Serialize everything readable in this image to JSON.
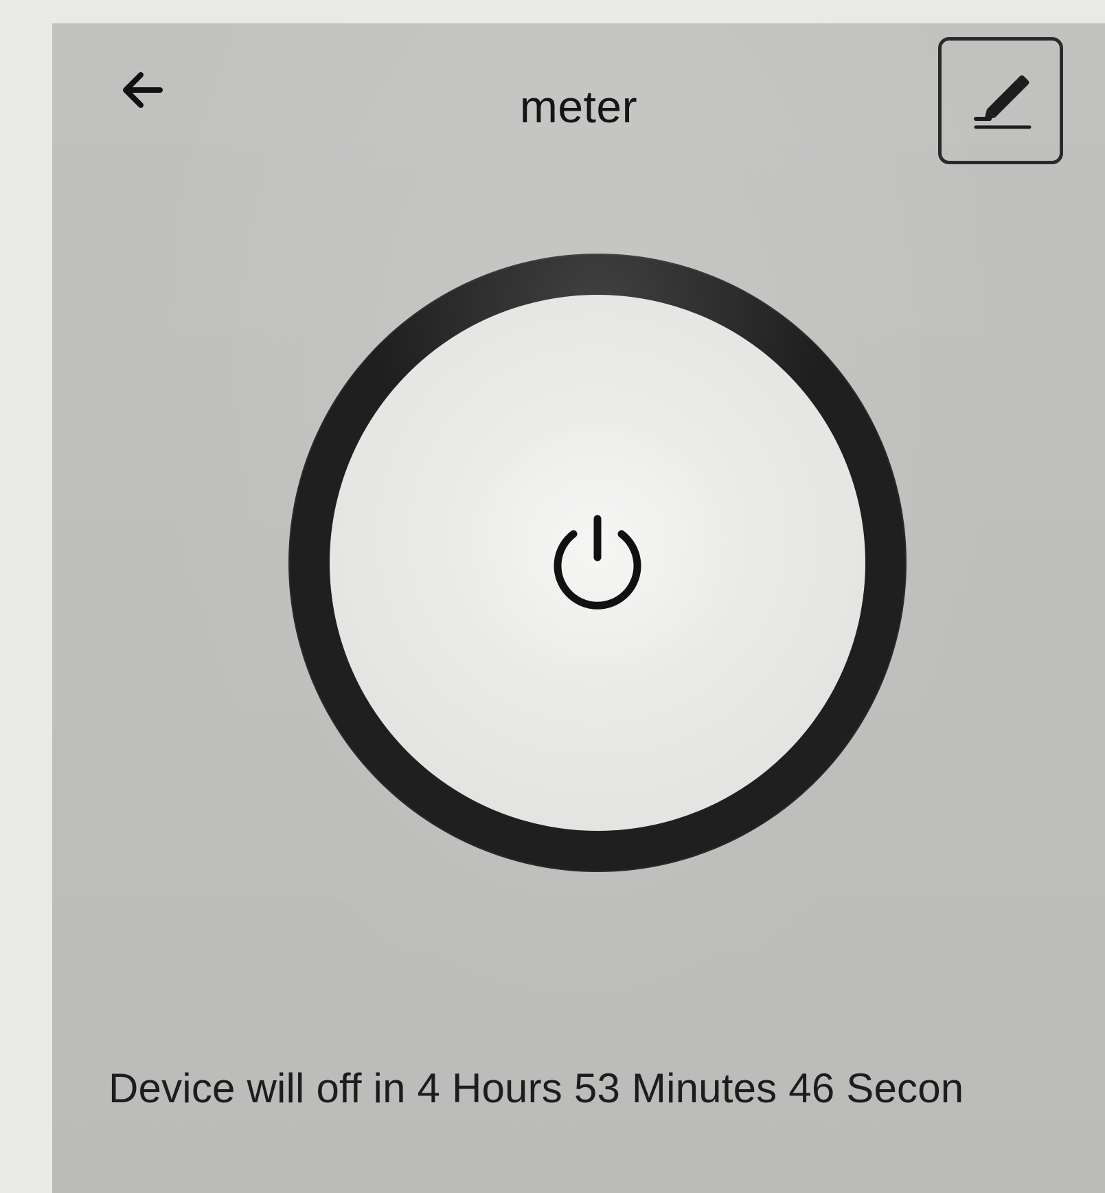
{
  "header": {
    "title": "meter",
    "back_icon": "arrow-left-icon",
    "edit_icon": "edit-pencil-icon"
  },
  "power_control": {
    "icon": "power-icon"
  },
  "status": {
    "text": "Device will off in 4 Hours 53 Minutes 46 Secon"
  },
  "colors": {
    "screen_background": "#c5c5c3",
    "ring": "#1f1f1f",
    "button_face": "#ececea",
    "text": "#151515"
  }
}
